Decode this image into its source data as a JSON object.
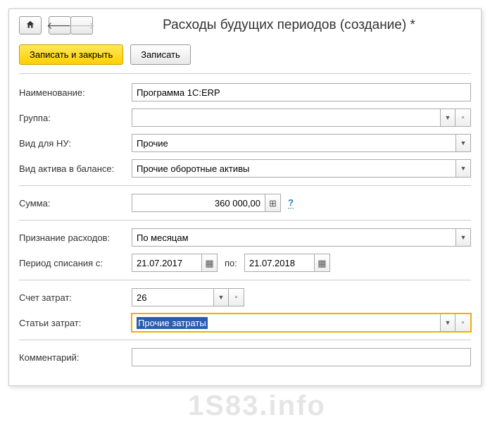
{
  "title": "Расходы будущих периодов (создание) *",
  "toolbar": {
    "save_close": "Записать и закрыть",
    "save": "Записать"
  },
  "labels": {
    "name": "Наименование:",
    "group": "Группа:",
    "nu_type": "Вид для НУ:",
    "balance_asset": "Вид актива в балансе:",
    "amount": "Сумма:",
    "recognition": "Признание расходов:",
    "period_from": "Период списания с:",
    "period_to": "по:",
    "cost_account": "Счет затрат:",
    "cost_items": "Статьи затрат:",
    "comment": "Комментарий:"
  },
  "values": {
    "name": "Программа 1С:ERP",
    "group": "",
    "nu_type": "Прочие",
    "balance_asset": "Прочие оборотные активы",
    "amount": "360 000,00",
    "recognition": "По месяцам",
    "period_from": "21.07.2017",
    "period_to": "21.07.2018",
    "cost_account": "26",
    "cost_items": "Прочие затраты",
    "comment": ""
  },
  "watermark": "1S83.info"
}
